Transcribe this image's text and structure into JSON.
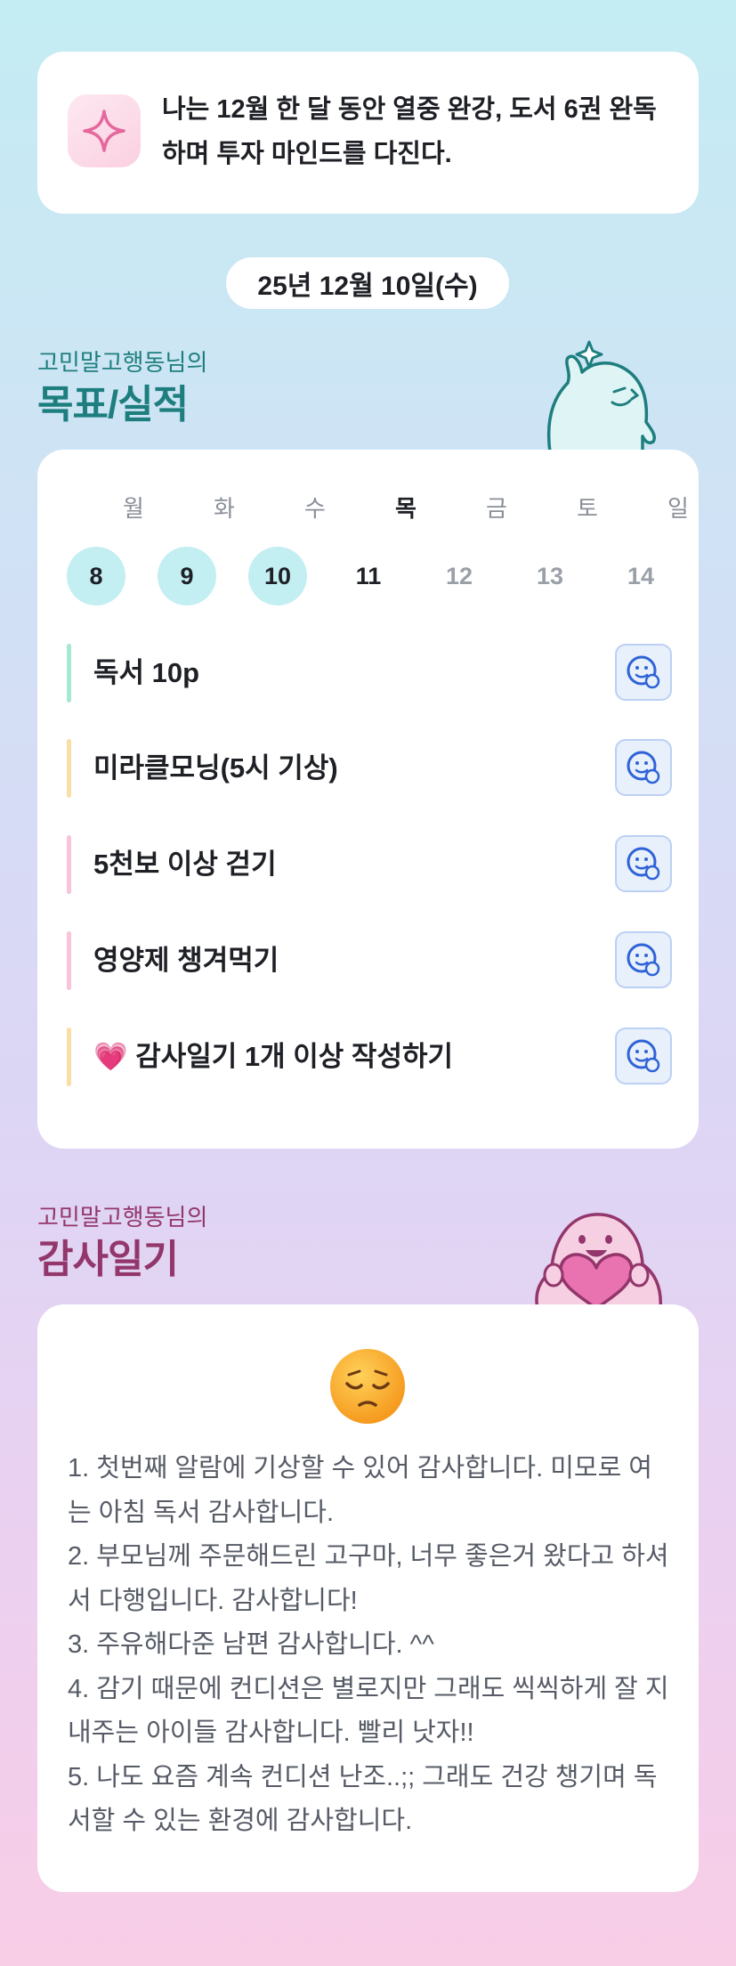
{
  "goal_banner": {
    "icon": "sparkle-icon",
    "text": "나는 12월 한 달 동안 열중 완강, 도서 6권 완독하며 투자 마인드를 다진다."
  },
  "date": "25년 12월 10일(수)",
  "goals_section": {
    "subtitle": "고민말고행동님의",
    "title": "목표/실적",
    "week": [
      {
        "day": "월",
        "date": "8",
        "state": "done"
      },
      {
        "day": "화",
        "date": "9",
        "state": "done"
      },
      {
        "day": "수",
        "date": "10",
        "state": "done"
      },
      {
        "day": "목",
        "date": "11",
        "state": "today"
      },
      {
        "day": "금",
        "date": "12",
        "state": "future"
      },
      {
        "day": "토",
        "date": "13",
        "state": "future"
      },
      {
        "day": "일",
        "date": "14",
        "state": "future"
      }
    ],
    "goals": [
      {
        "label": "독서 10p",
        "bar_color": "#a6e8d3"
      },
      {
        "label": "미라클모닝(5시 기상)",
        "bar_color": "#f9dfa6"
      },
      {
        "label": "5천보 이상 걷기",
        "bar_color": "#f7c4dc"
      },
      {
        "label": "영양제 챙겨먹기",
        "bar_color": "#f7c4dc"
      },
      {
        "label": "💗  감사일기 1개 이상 작성하기",
        "bar_color": "#f9dfa6"
      }
    ],
    "action_icon": "smile-face-add-icon"
  },
  "gratitude_section": {
    "subtitle": "고민말고행동님의",
    "title": "감사일기",
    "mood_icon": "pensive-face-icon",
    "entries": [
      "1. 첫번째 알람에 기상할 수 있어 감사합니다. 미모로 여는 아침 독서 감사합니다.",
      "2. 부모님께 주문해드린 고구마, 너무 좋은거 왔다고 하셔서 다행입니다. 감사합니다!",
      "3. 주유해다준 남편 감사합니다. ^^",
      "4. 감기 때문에 컨디션은 별로지만 그래도 씩씩하게 잘 지내주는 아이들 감사합니다. 빨리 낫자!!",
      "5. 나도 요즘 계속 컨디션 난조..;; 그래도 건강 챙기며 독서할 수 있는 환경에 감사합니다."
    ]
  }
}
